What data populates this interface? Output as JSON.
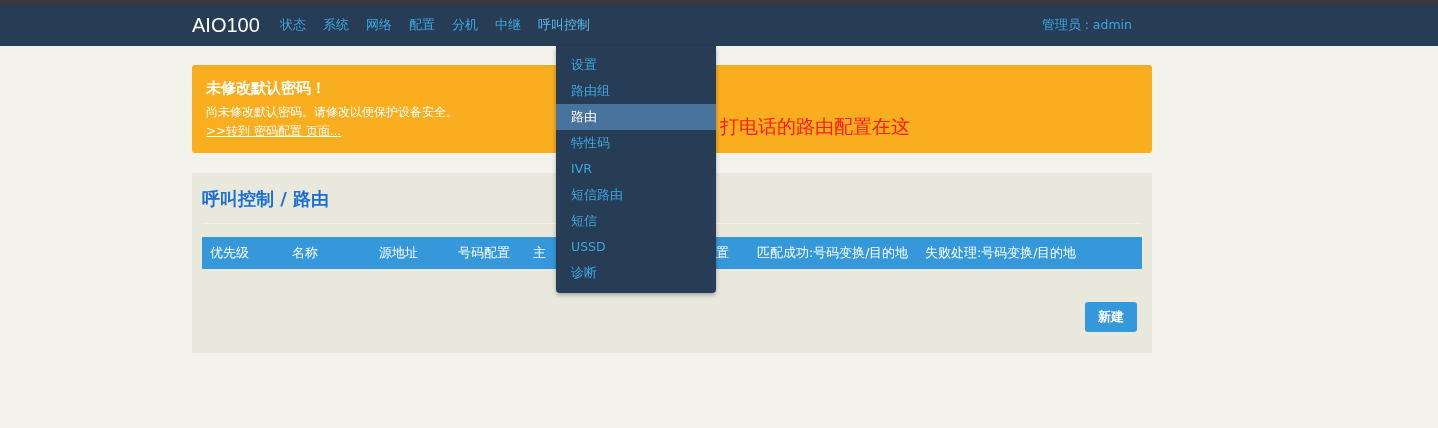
{
  "navbar": {
    "brand": "AIO100",
    "items": [
      {
        "label": "状态",
        "selected": false
      },
      {
        "label": "系统",
        "selected": false
      },
      {
        "label": "网络",
        "selected": false
      },
      {
        "label": "配置",
        "selected": false
      },
      {
        "label": "分机",
        "selected": false
      },
      {
        "label": "中继",
        "selected": false
      },
      {
        "label": "呼叫控制",
        "selected": true
      }
    ],
    "user": "管理员 : admin"
  },
  "dropdown": {
    "items": [
      {
        "label": "设置",
        "selected": false
      },
      {
        "label": "路由组",
        "selected": false
      },
      {
        "label": "路由",
        "selected": true
      },
      {
        "label": "特性码",
        "selected": false
      },
      {
        "label": "IVR",
        "selected": false
      },
      {
        "label": "短信路由",
        "selected": false
      },
      {
        "label": "短信",
        "selected": false
      },
      {
        "label": "USSD",
        "selected": false
      },
      {
        "label": "诊断",
        "selected": false
      }
    ]
  },
  "alert": {
    "title": "未修改默认密码！",
    "message": "尚未修改默认密码。请修改以便保护设备安全。",
    "link": ">>转到 密码配置 页面..."
  },
  "annotation": "打电话的路由配置在这",
  "panel": {
    "title": "呼叫控制 / 路由",
    "table": {
      "columns": [
        "优先级",
        "名称",
        "源地址",
        "号码配置",
        "主",
        "置",
        "匹配成功:号码变换/目的地",
        "失败处理:号码变换/目的地"
      ]
    },
    "new_button": "新建"
  }
}
